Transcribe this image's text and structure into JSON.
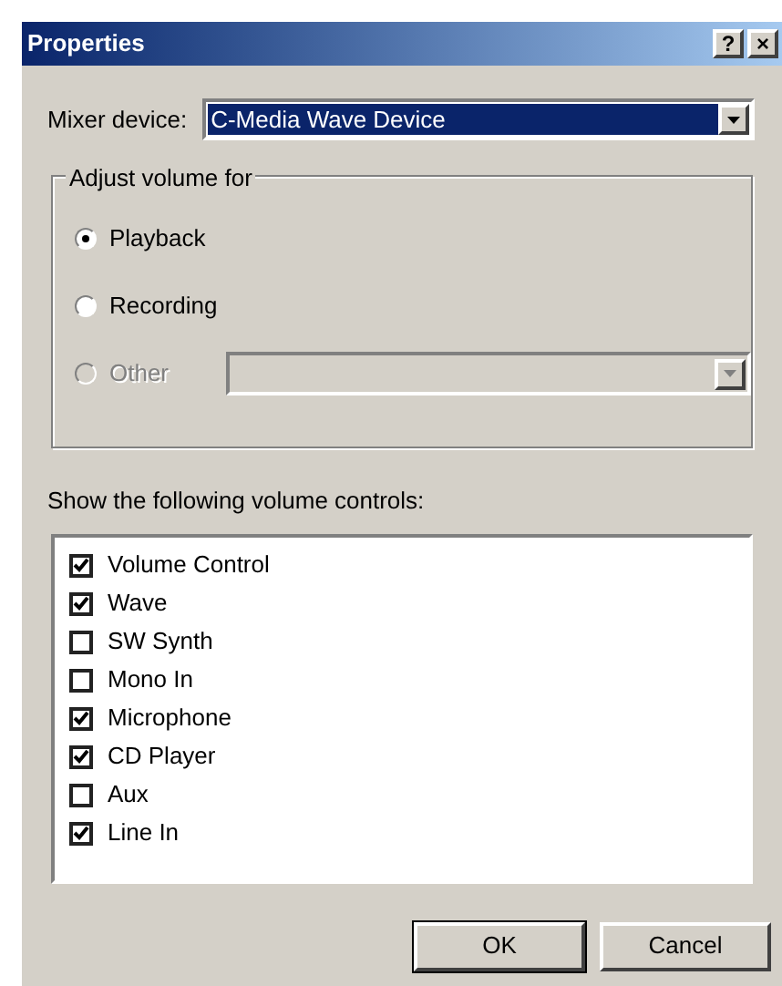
{
  "window": {
    "title": "Properties",
    "buttons": [
      "?",
      "×"
    ]
  },
  "mixer": {
    "label": "Mixer device:",
    "value": "C-Media Wave Device"
  },
  "adjust": {
    "title": "Adjust volume for",
    "options": [
      {
        "label": "Playback",
        "selected": true,
        "disabled": false
      },
      {
        "label": "Recording",
        "selected": false,
        "disabled": false
      },
      {
        "label": "Other",
        "selected": false,
        "disabled": true
      }
    ]
  },
  "controls": {
    "label": "Show the following volume controls:",
    "items": [
      {
        "label": "Volume Control",
        "checked": true
      },
      {
        "label": "Wave",
        "checked": true
      },
      {
        "label": "SW Synth",
        "checked": false
      },
      {
        "label": "Mono In",
        "checked": false
      },
      {
        "label": "Microphone",
        "checked": true
      },
      {
        "label": "CD Player",
        "checked": true
      },
      {
        "label": "Aux",
        "checked": false
      },
      {
        "label": "Line In",
        "checked": true
      }
    ]
  },
  "buttons": [
    "OK",
    "Cancel"
  ]
}
